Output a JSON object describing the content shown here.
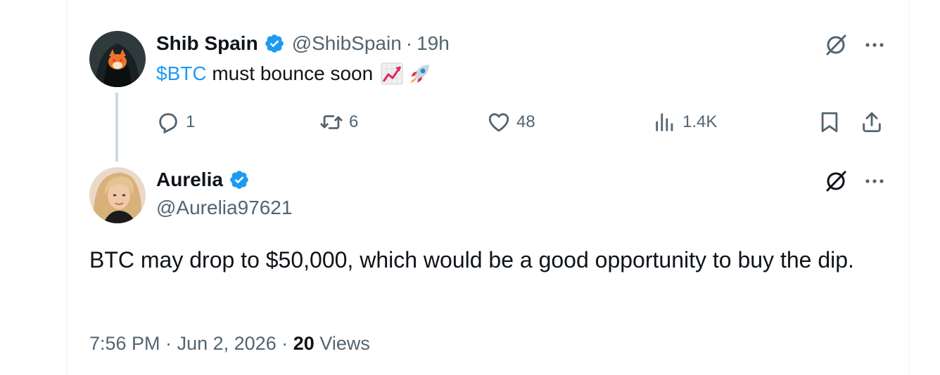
{
  "parent_tweet": {
    "display_name": "Shib Spain",
    "handle": "@ShibSpain",
    "separator": "·",
    "time": "19h",
    "cashtag": "$BTC",
    "text": " must bounce soon",
    "emojis": [
      "chart-increasing-emoji",
      "rocket-emoji"
    ],
    "actions": {
      "replies": "1",
      "reposts": "6",
      "likes": "48",
      "views": "1.4K"
    }
  },
  "main_tweet": {
    "display_name": "Aurelia",
    "handle": "@Aurelia97621",
    "text": "BTC may drop to $50,000, which would be a good opportunity to buy the dip.",
    "time": "7:56 PM",
    "separator": "·",
    "date": "Jun 2, 2026",
    "views_count": "20",
    "views_label": "Views"
  },
  "colors": {
    "accent": "#1d9bf0",
    "secondary_text": "#536471",
    "primary_text": "#0f1419",
    "thread_line": "#cfd9de"
  }
}
